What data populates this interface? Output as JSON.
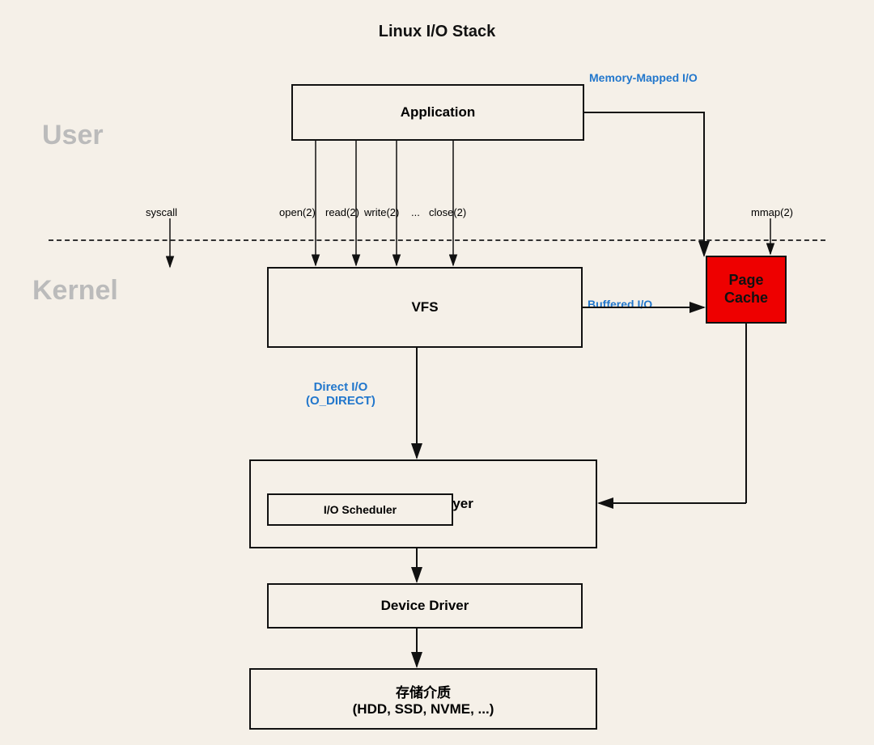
{
  "title": "Linux I/O Stack",
  "layers": {
    "user_label": "User",
    "kernel_label": "Kernel"
  },
  "boxes": {
    "application": "Application",
    "vfs": "VFS",
    "block_io_layer": "Block I/O Layer",
    "io_scheduler": "I/O Scheduler",
    "device_driver": "Device Driver",
    "storage": "存储介质\n(HDD, SSD, NVME, ...)",
    "page_cache_line1": "Page",
    "page_cache_line2": "Cache"
  },
  "labels": {
    "syscall": "syscall",
    "open": "open(2)",
    "read": "read(2)",
    "write": "write(2)",
    "dots": "...",
    "close": "close(2)",
    "mmap": "mmap(2)",
    "memory_mapped_io": "Memory-Mapped I/O",
    "buffered_io": "Buffered I/O",
    "direct_io_line1": "Direct I/O",
    "direct_io_line2": "(O_DIRECT)"
  },
  "colors": {
    "background": "#f5f0e8",
    "text_primary": "#111111",
    "text_secondary": "#bbbbbb",
    "accent_blue": "#2277cc",
    "page_cache_bg": "#ee0000",
    "border": "#111111"
  }
}
